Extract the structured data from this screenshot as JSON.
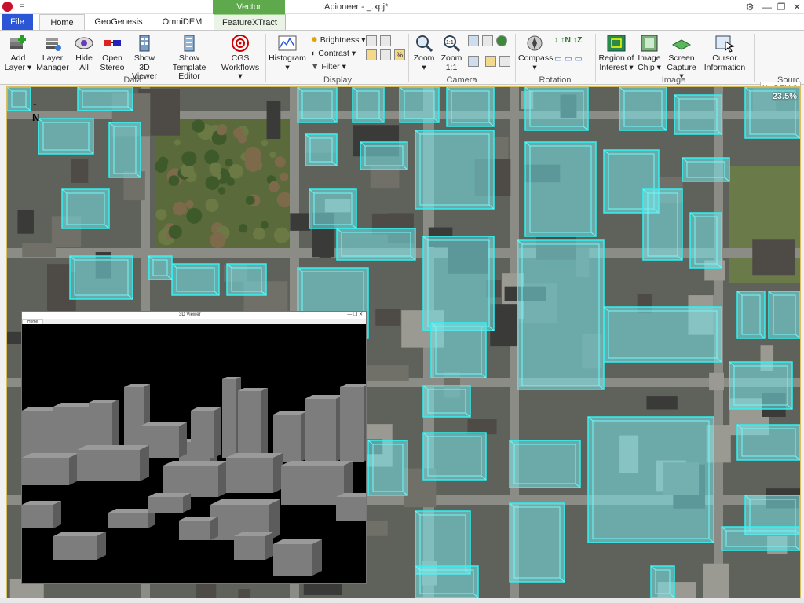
{
  "titlebar": {
    "quick_access": "| =",
    "vector_context": "Vector",
    "title": "IApioneer - _.xpj*"
  },
  "tabs": {
    "file": "File",
    "home": "Home",
    "geogenesis": "GeoGenesis",
    "omnidem": "OmniDEM",
    "featurextract": "FeatureXTract"
  },
  "ribbon": {
    "data": {
      "label": "Data",
      "add_layer": "Add Layer ▾",
      "layer_manager": "Layer Manager",
      "hide_all": "Hide All",
      "open_stereo": "Open Stereo",
      "show_3d_viewer": "Show 3D Viewer",
      "show_template_editor": "Show Template Editor",
      "cgs_workflows": "CGS Workflows ▾"
    },
    "display": {
      "label": "Display",
      "histogram": "Histogram ▾",
      "brightness": "Brightness ▾",
      "contrast": "Contrast ▾",
      "filter": "Filter ▾"
    },
    "camera": {
      "label": "Camera",
      "zoom": "Zoom ▾",
      "zoom_1_1": "Zoom 1:1"
    },
    "rotation": {
      "label": "Rotation",
      "compass": "Compass ▾"
    },
    "image": {
      "label": "Image",
      "region_of_interest": "Region of Interest ▾",
      "image_chip": "Image Chip ▾",
      "screen_capture": "Screen Capture ▾",
      "cursor_information": "Cursor Information"
    },
    "source": {
      "label": "Sourc",
      "dem_select": "No DEM Se"
    }
  },
  "map": {
    "zoom_percent": "23.5%",
    "north_label": "N"
  },
  "viewer3d": {
    "title": "3D Viewer",
    "home_tab": "Home"
  }
}
